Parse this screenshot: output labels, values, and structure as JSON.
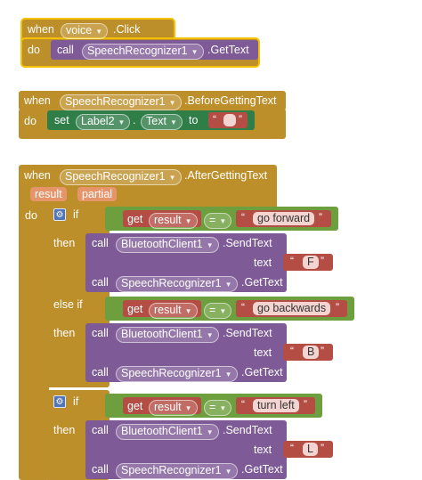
{
  "labels": {
    "when": "when",
    "do": "do",
    "call": "call",
    "set": "set",
    "to": "to",
    "get": "get",
    "if": "if",
    "then": "then",
    "else_if": "else if",
    "text": "text",
    "eq": "=",
    "dot": "."
  },
  "block1": {
    "component": "voice",
    "event": ".Click",
    "call_component": "SpeechRecognizer1",
    "method": ".GetText"
  },
  "block2": {
    "component": "SpeechRecognizer1",
    "event": ".BeforeGettingText",
    "set_component": "Label2",
    "property": "Text",
    "value": ""
  },
  "block3": {
    "component": "SpeechRecognizer1",
    "event": ".AfterGettingText",
    "params": [
      "result",
      "partial"
    ],
    "var": "result",
    "bt_component": "BluetoothClient1",
    "bt_method": ".SendText",
    "sr_component": "SpeechRecognizer1",
    "sr_method": ".GetText",
    "conditions": [
      {
        "compare": "go forward",
        "send": "F"
      },
      {
        "compare": "go backwards",
        "send": "B"
      },
      {
        "compare": "turn left",
        "send": "L"
      }
    ]
  }
}
